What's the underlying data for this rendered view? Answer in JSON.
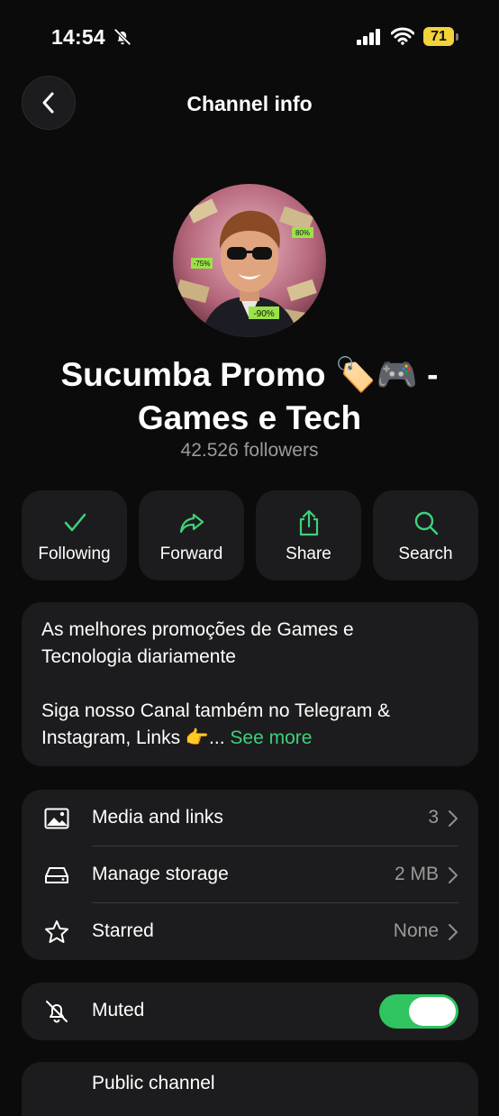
{
  "status_bar": {
    "time": "14:54",
    "battery": "71"
  },
  "header": {
    "title": "Channel info"
  },
  "channel": {
    "name_line1": "Sucumba Promo 🏷️🎮  -",
    "name_line2": "Games e Tech",
    "followers": "42.526 followers",
    "avatar_tags": [
      "-75%",
      "80%",
      "-90%"
    ]
  },
  "actions": [
    {
      "label": "Following",
      "icon": "check-icon"
    },
    {
      "label": "Forward",
      "icon": "forward-icon"
    },
    {
      "label": "Share",
      "icon": "share-icon"
    },
    {
      "label": "Search",
      "icon": "search-icon"
    }
  ],
  "description": {
    "line1": "As melhores promoções de Games e",
    "line2": "Tecnologia diariamente",
    "line3": "Siga nosso Canal também no Telegram &",
    "line4": "Instagram, Links 👉...",
    "see_more": "See more"
  },
  "list": [
    {
      "label": "Media and links",
      "value": "3",
      "icon": "image-icon"
    },
    {
      "label": "Manage storage",
      "value": "2 MB",
      "icon": "storage-icon"
    },
    {
      "label": "Starred",
      "value": "None",
      "icon": "star-icon"
    }
  ],
  "muted": {
    "label": "Muted",
    "enabled": true
  },
  "next_row": {
    "label": "Public channel"
  },
  "colors": {
    "accent": "#3fd17a",
    "toggle_on": "#2fc45f",
    "card": "#1c1c1e",
    "background": "#0b0b0b"
  }
}
